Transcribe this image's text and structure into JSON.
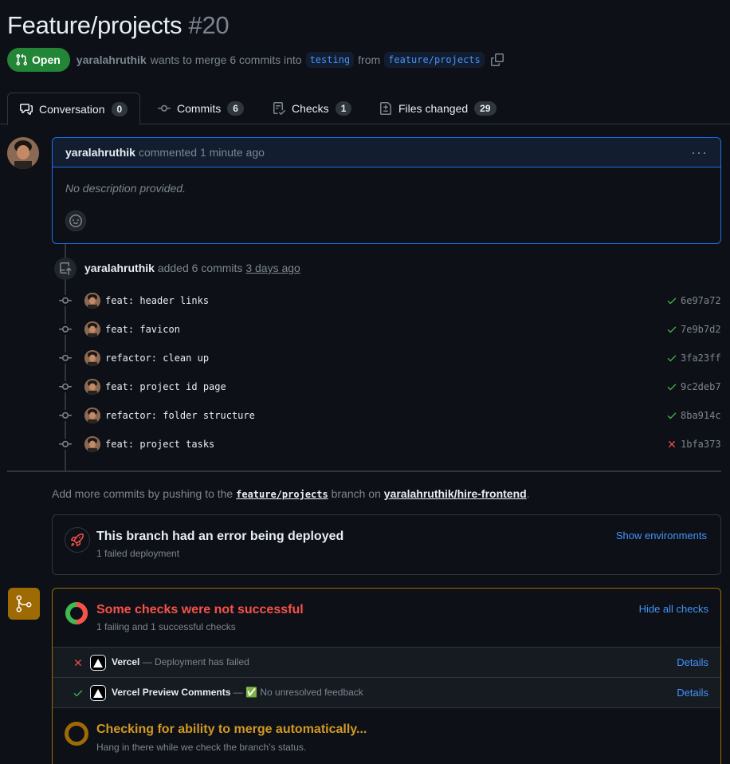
{
  "header": {
    "title": "Feature/projects",
    "number": "#20",
    "status_label": "Open",
    "author": "yaralahruthik",
    "merge_text": "wants to merge 6 commits into",
    "base_branch": "testing",
    "from_text": "from",
    "head_branch": "feature/projects"
  },
  "tabs": [
    {
      "label": "Conversation",
      "count": "0",
      "icon": "comment-discussion-icon"
    },
    {
      "label": "Commits",
      "count": "6",
      "icon": "git-commit-icon"
    },
    {
      "label": "Checks",
      "count": "1",
      "icon": "checklist-icon"
    },
    {
      "label": "Files changed",
      "count": "29",
      "icon": "file-diff-icon"
    }
  ],
  "comment": {
    "author": "yaralahruthik",
    "meta": "commented 1 minute ago",
    "menu": "···",
    "body": "No description provided."
  },
  "push_event": {
    "author": "yaralahruthik",
    "text": "added 6 commits",
    "time": "3 days ago"
  },
  "commits": [
    {
      "message": "feat: header links",
      "sha": "6e97a72",
      "status": "success"
    },
    {
      "message": "feat: favicon",
      "sha": "7e9b7d2",
      "status": "success"
    },
    {
      "message": "refactor: clean up",
      "sha": "3fa23ff",
      "status": "success"
    },
    {
      "message": "feat: project id page",
      "sha": "9c2deb7",
      "status": "success"
    },
    {
      "message": "refactor: folder structure",
      "sha": "8ba914c",
      "status": "success"
    },
    {
      "message": "feat: project tasks",
      "sha": "1bfa373",
      "status": "failure"
    }
  ],
  "push_hint": {
    "prefix": "Add more commits by pushing to the",
    "branch": "feature/projects",
    "middle": "branch on",
    "repo": "yaralahruthik/hire-frontend",
    "suffix": "."
  },
  "deployment": {
    "title": "This branch had an error being deployed",
    "subtitle": "1 failed deployment",
    "link": "Show environments"
  },
  "checks": {
    "title": "Some checks were not successful",
    "subtitle": "1 failing and 1 successful checks",
    "link": "Hide all checks",
    "items": [
      {
        "name": "Vercel",
        "description": "— Deployment has failed",
        "status": "failure",
        "details": "Details"
      },
      {
        "name": "Vercel Preview Comments",
        "description": "— ✅ No unresolved feedback",
        "status": "success",
        "details": "Details"
      }
    ]
  },
  "merge_status": {
    "title": "Checking for ability to merge automatically...",
    "subtitle": "Hang in there while we check the branch’s status."
  },
  "colors": {
    "background": "#0d1117",
    "open_green": "#238636",
    "link_blue": "#4493f8",
    "failure_red": "#f85149",
    "success_green": "#3fb950",
    "pending_yellow": "#d29922"
  }
}
